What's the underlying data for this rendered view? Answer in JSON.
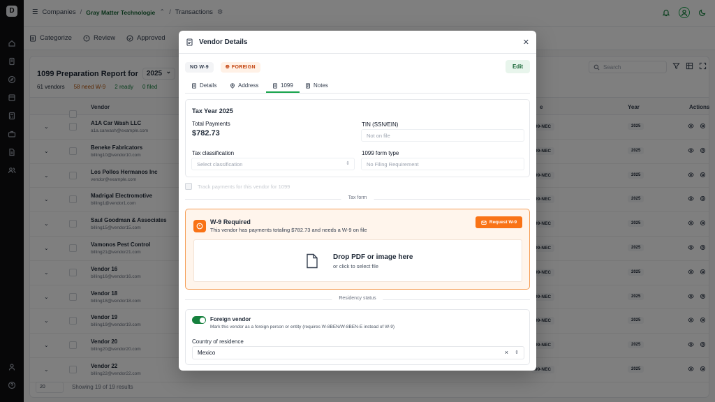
{
  "rail": {
    "logo": "D"
  },
  "breadcrumb": {
    "root": "Companies",
    "company": "Gray Matter Technologie",
    "page": "Transactions"
  },
  "subnav": {
    "categorize": "Categorize",
    "review": "Review",
    "approved": "Approved"
  },
  "report": {
    "title": "1099 Preparation Report for",
    "year": "2025",
    "stats": {
      "vendors": "61 vendors",
      "need_w9": "58 need W-9",
      "ready": "2 ready",
      "filed": "0 filed"
    },
    "search_placeholder": "Search",
    "columns": {
      "vendor": "Vendor",
      "form": "e",
      "year": "Year",
      "actions": "Actions"
    },
    "rows": [
      {
        "name": "A1A Car Wash LLC",
        "email": "a1a.carwash@example.com",
        "form": "99-NEC",
        "year": "2025"
      },
      {
        "name": "Beneke Fabricators",
        "email": "billing10@vendor10.com",
        "form": "99-NEC",
        "year": "2025"
      },
      {
        "name": "Los Pollos Hermanos Inc",
        "email": "vendor@example.com",
        "form": "99-NEC",
        "year": "2025"
      },
      {
        "name": "Madrigal Electromotive",
        "email": "billing1@vendor1.com",
        "form": "99-NEC",
        "year": "2025"
      },
      {
        "name": "Saul Goodman & Associates",
        "email": "billing15@vendor15.com",
        "form": "99-NEC",
        "year": "2025"
      },
      {
        "name": "Vamonos Pest Control",
        "email": "billing21@vendor21.com",
        "form": "99-NEC",
        "year": "2025"
      },
      {
        "name": "Vendor 16",
        "email": "billing16@vendor16.com",
        "form": "99-NEC",
        "year": "2025"
      },
      {
        "name": "Vendor 18",
        "email": "billing18@vendor18.com",
        "form": "99-NEC",
        "year": "2025"
      },
      {
        "name": "Vendor 19",
        "email": "billing19@vendor19.com",
        "form": "99-NEC",
        "year": "2025"
      },
      {
        "name": "Vendor 20",
        "email": "billing20@vendor20.com",
        "form": "99-NEC",
        "year": "2025"
      },
      {
        "name": "Vendor 22",
        "email": "billing22@vendor22.com",
        "form": "99-NEC",
        "year": "2025"
      }
    ],
    "page_size": "20",
    "results": "Showing 19 of 19 results"
  },
  "modal": {
    "title": "Vendor Details",
    "badges": {
      "no_w9": "NO W-9",
      "foreign": "FOREIGN"
    },
    "edit": "Edit",
    "tabs": [
      "Details",
      "Address",
      "1099",
      "Notes"
    ],
    "tax": {
      "title": "Tax Year 2025",
      "total_label": "Total Payments",
      "total_value": "$782.73",
      "tin_label": "TIN (SSN/EIN)",
      "tin_placeholder": "Not on file",
      "class_label": "Tax classification",
      "class_placeholder": "Select classification",
      "formtype_label": "1099 form type",
      "formtype_value": "No Filing Requirement"
    },
    "skip_label": "Track payments for this vendor for 1099",
    "divider_taxform": "Tax form",
    "w9": {
      "title": "W-9 Required",
      "subtitle": "This vendor has payments totaling $782.73 and needs a W-9 on file",
      "request": "Request W-9",
      "drop_title": "Drop PDF or image here",
      "drop_sub": "or click to select file"
    },
    "divider_residency": "Residency status",
    "residency": {
      "foreign_label": "Foreign vendor",
      "foreign_desc": "Mark this vendor as a foreign person or entity (requires W-8BEN/W-8BEN-E instead of W-9)",
      "country_label": "Country of residence",
      "country_value": "Mexico"
    }
  },
  "colors": {
    "accent": "#16a34a",
    "warning": "#f97316",
    "foreign_badge": "#c2410c"
  }
}
